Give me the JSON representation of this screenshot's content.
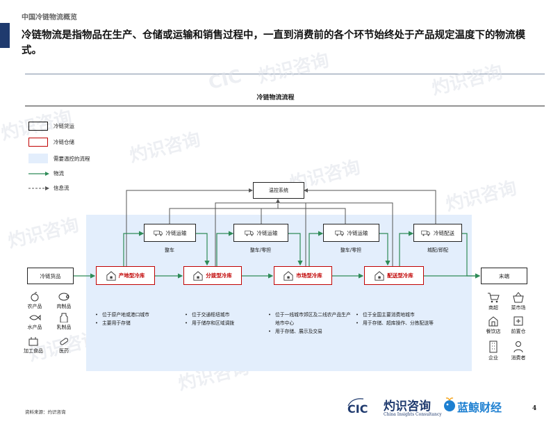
{
  "header": {
    "section_title": "中国冷链物流概览",
    "headline": "冷链物流是指物品在生产、仓储或运输和销售过程中，一直到消费前的各个环节始终处于产品规定温度下的物流模式。"
  },
  "diagram": {
    "title": "冷链物流流程",
    "legend": [
      {
        "label": "冷链货运"
      },
      {
        "label": "冷链仓储"
      },
      {
        "label": "需要温控的流程"
      },
      {
        "label": "物流"
      },
      {
        "label": "信息流"
      }
    ],
    "monitor_label": "温控系统",
    "source_label": "冷链货品",
    "end_label": "末端",
    "transports": [
      {
        "label": "冷链运输",
        "sub": "整车"
      },
      {
        "label": "冷链运输",
        "sub": "整车/零担"
      },
      {
        "label": "冷链运输",
        "sub": "整车/零担"
      },
      {
        "label": "冷链配送",
        "sub": "城配/即配"
      }
    ],
    "warehouses": [
      {
        "label": "产地型冷库"
      },
      {
        "label": "分拨型冷库"
      },
      {
        "label": "市场型冷库"
      },
      {
        "label": "配送型冷库"
      }
    ],
    "bullets": [
      [
        "位于原产地或港口城市",
        "主要用于存储"
      ],
      [
        "位于交通枢纽城市",
        "用于储存和区域调拨"
      ],
      [
        "位于一线城市郊区及二线农产品生产地市中心",
        "用于存储、展示及交易"
      ],
      [
        "位于全国主要消费地城市",
        "用于存储、超库操作、分拣配送等"
      ]
    ],
    "source_items": [
      {
        "label": "农产品",
        "icon": "apple-icon"
      },
      {
        "label": "肉制品",
        "icon": "pig-icon"
      },
      {
        "label": "水产品",
        "icon": "fish-icon"
      },
      {
        "label": "乳制品",
        "icon": "milk-icon"
      },
      {
        "label": "加工食品",
        "icon": "processed-food-icon"
      },
      {
        "label": "医药",
        "icon": "medicine-icon"
      }
    ],
    "end_items": [
      {
        "label": "商超",
        "icon": "cart-icon"
      },
      {
        "label": "菜市场",
        "icon": "basket-icon"
      },
      {
        "label": "餐饮店",
        "icon": "restaurant-icon"
      },
      {
        "label": "前置仓",
        "icon": "warehouse-icon"
      },
      {
        "label": "企业",
        "icon": "building-icon"
      },
      {
        "label": "消费者",
        "icon": "person-icon"
      }
    ]
  },
  "footer": {
    "source": "资料来源：灼识咨询",
    "page_number": "4",
    "logo_cic": "CIC",
    "logo_cn": "灼识咨询",
    "logo_en": "China Insights Consultancy",
    "partner_logo": "蓝鲸财经"
  },
  "watermark": {
    "cn": "灼识咨询",
    "en": "China Insights Consultancy",
    "short": "CIC"
  },
  "colors": {
    "accent": "#1f3a6e",
    "warehouse_border": "#c00000",
    "flow_green": "#2e8b57",
    "region_fill": "#e3eefc",
    "partner_blue": "#1c7fd1"
  }
}
